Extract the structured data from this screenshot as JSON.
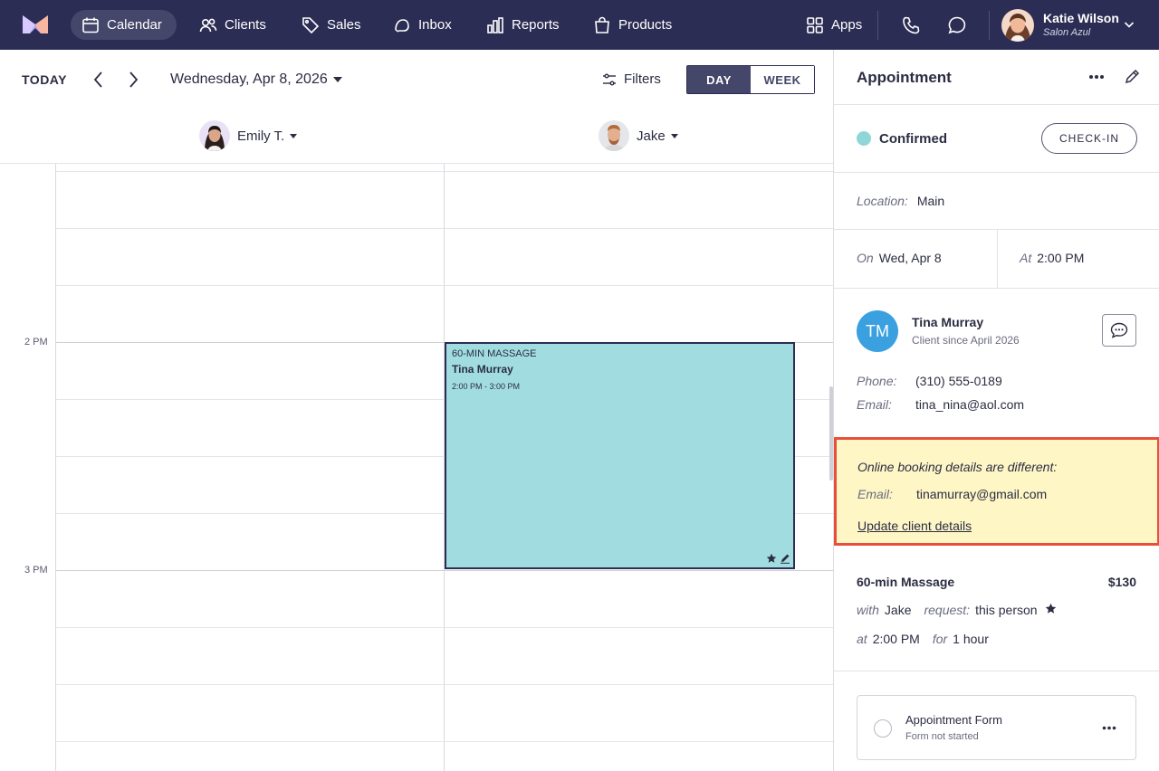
{
  "nav": {
    "items": [
      {
        "label": "Calendar",
        "icon": "calendar-icon"
      },
      {
        "label": "Clients",
        "icon": "clients-icon"
      },
      {
        "label": "Sales",
        "icon": "tag-icon"
      },
      {
        "label": "Inbox",
        "icon": "inbox-icon"
      },
      {
        "label": "Reports",
        "icon": "bar-chart-icon"
      },
      {
        "label": "Products",
        "icon": "shopping-bag-icon"
      }
    ],
    "apps_label": "Apps",
    "user": {
      "name": "Katie Wilson",
      "salon": "Salon Azul"
    }
  },
  "toolbar": {
    "today_label": "TODAY",
    "date": "Wednesday, Apr 8, 2026",
    "filters_label": "Filters",
    "view_day": "DAY",
    "view_week": "WEEK"
  },
  "staff": [
    {
      "name": "Emily T."
    },
    {
      "name": "Jake"
    }
  ],
  "calendar": {
    "time_labels": [
      "2 PM",
      "3 PM"
    ],
    "appointment": {
      "service": "60-MIN MASSAGE",
      "client": "Tina Murray",
      "time": "2:00 PM - 3:00 PM"
    }
  },
  "panel": {
    "title": "Appointment",
    "status": "Confirmed",
    "checkin_label": "CHECK-IN",
    "location_label": "Location:",
    "location": "Main",
    "on_label": "On",
    "on_value": "Wed, Apr 8",
    "at_label": "At",
    "at_value": "2:00 PM",
    "client": {
      "initials": "TM",
      "name": "Tina Murray",
      "since": "Client since April 2026",
      "phone_label": "Phone:",
      "phone": "(310) 555-0189",
      "email_label": "Email:",
      "email": "tina_nina@aol.com"
    },
    "notice": {
      "heading": "Online booking details are different:",
      "email_label": "Email:",
      "email": "tinamurray@gmail.com",
      "link": "Update client details"
    },
    "service": {
      "name": "60-min Massage",
      "price": "$130",
      "with_label": "with",
      "with_value": "Jake",
      "request_label": "request:",
      "request_value": "this person",
      "at_label": "at",
      "at_value": "2:00 PM",
      "for_label": "for",
      "for_value": "1 hour"
    },
    "form": {
      "name": "Appointment Form",
      "status": "Form not started"
    }
  },
  "colors": {
    "nav_bg": "#2c2d54",
    "appointment_fill": "#a1dde0",
    "status_confirmed": "#8fd6d8",
    "notice_bg": "#fff6c6",
    "notice_border": "#e84f3a",
    "client_avatar": "#3aa0e0"
  }
}
